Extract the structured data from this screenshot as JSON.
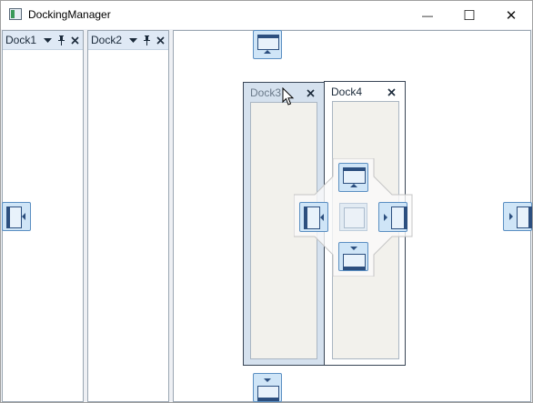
{
  "window": {
    "title": "DockingManager",
    "minimize_symbol": "—",
    "maximize_symbol": "☐",
    "close_symbol": "✕"
  },
  "dock_panes": [
    {
      "title": "Dock1",
      "menu_icon": "dropdown-arrow-icon",
      "pin_icon": "pin-icon",
      "close_icon": "close-icon"
    },
    {
      "title": "Dock2",
      "menu_icon": "dropdown-arrow-icon",
      "pin_icon": "pin-icon",
      "close_icon": "close-icon"
    }
  ],
  "floating_windows": [
    {
      "title": "Dock3",
      "close_icon": "close-icon"
    },
    {
      "title": "Dock4",
      "close_icon": "close-icon"
    }
  ],
  "dock_guides": [
    "dock-top",
    "dock-bottom",
    "dock-left",
    "dock-right",
    "dock-center"
  ],
  "colors": {
    "header_bg": "#dfe9f5",
    "guide_bg": "#cfe5f7",
    "guide_border": "#5b8fc2",
    "guide_inner_border": "#2c4f7f",
    "float_frame": "#d5e1ee",
    "float_body": "#f2f1ec"
  }
}
